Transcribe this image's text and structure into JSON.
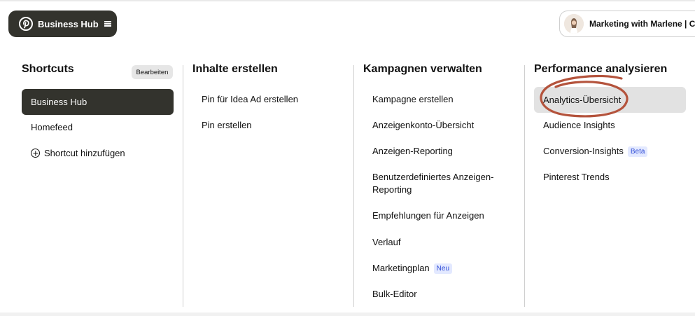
{
  "header": {
    "hub_label": "Business Hub",
    "account_label": "Marketing with Marlene | C"
  },
  "shortcuts": {
    "title": "Shortcuts",
    "edit_label": "Bearbeiten",
    "items": [
      {
        "label": "Business Hub",
        "active": true
      },
      {
        "label": "Homefeed"
      },
      {
        "label": "Shortcut hinzufügen",
        "icon": "plus-circle-icon"
      }
    ]
  },
  "create": {
    "title": "Inhalte erstellen",
    "items": [
      {
        "label": "Pin für Idea Ad erstellen"
      },
      {
        "label": "Pin erstellen"
      }
    ]
  },
  "campaigns": {
    "title": "Kampagnen verwalten",
    "items": [
      {
        "label": "Kampagne erstellen"
      },
      {
        "label": "Anzeigenkonto-Übersicht"
      },
      {
        "label": "Anzeigen-Reporting"
      },
      {
        "label": "Benutzerdefiniertes Anzeigen-Reporting"
      },
      {
        "label": "Empfehlungen für Anzeigen"
      },
      {
        "label": "Verlauf"
      },
      {
        "label": "Marketingplan",
        "badge": "Neu"
      },
      {
        "label": "Bulk-Editor"
      }
    ]
  },
  "performance": {
    "title": "Performance analysieren",
    "items": [
      {
        "label": "Analytics-Übersicht",
        "highlighted": true
      },
      {
        "label": "Audience Insights"
      },
      {
        "label": "Conversion-Insights",
        "badge": "Beta"
      },
      {
        "label": "Pinterest Trends"
      }
    ]
  },
  "colors": {
    "dark_button": "#33332d",
    "annotation_circle": "#b4533c",
    "badge_bg": "#e3e9ff",
    "badge_text": "#2e4bd6"
  }
}
